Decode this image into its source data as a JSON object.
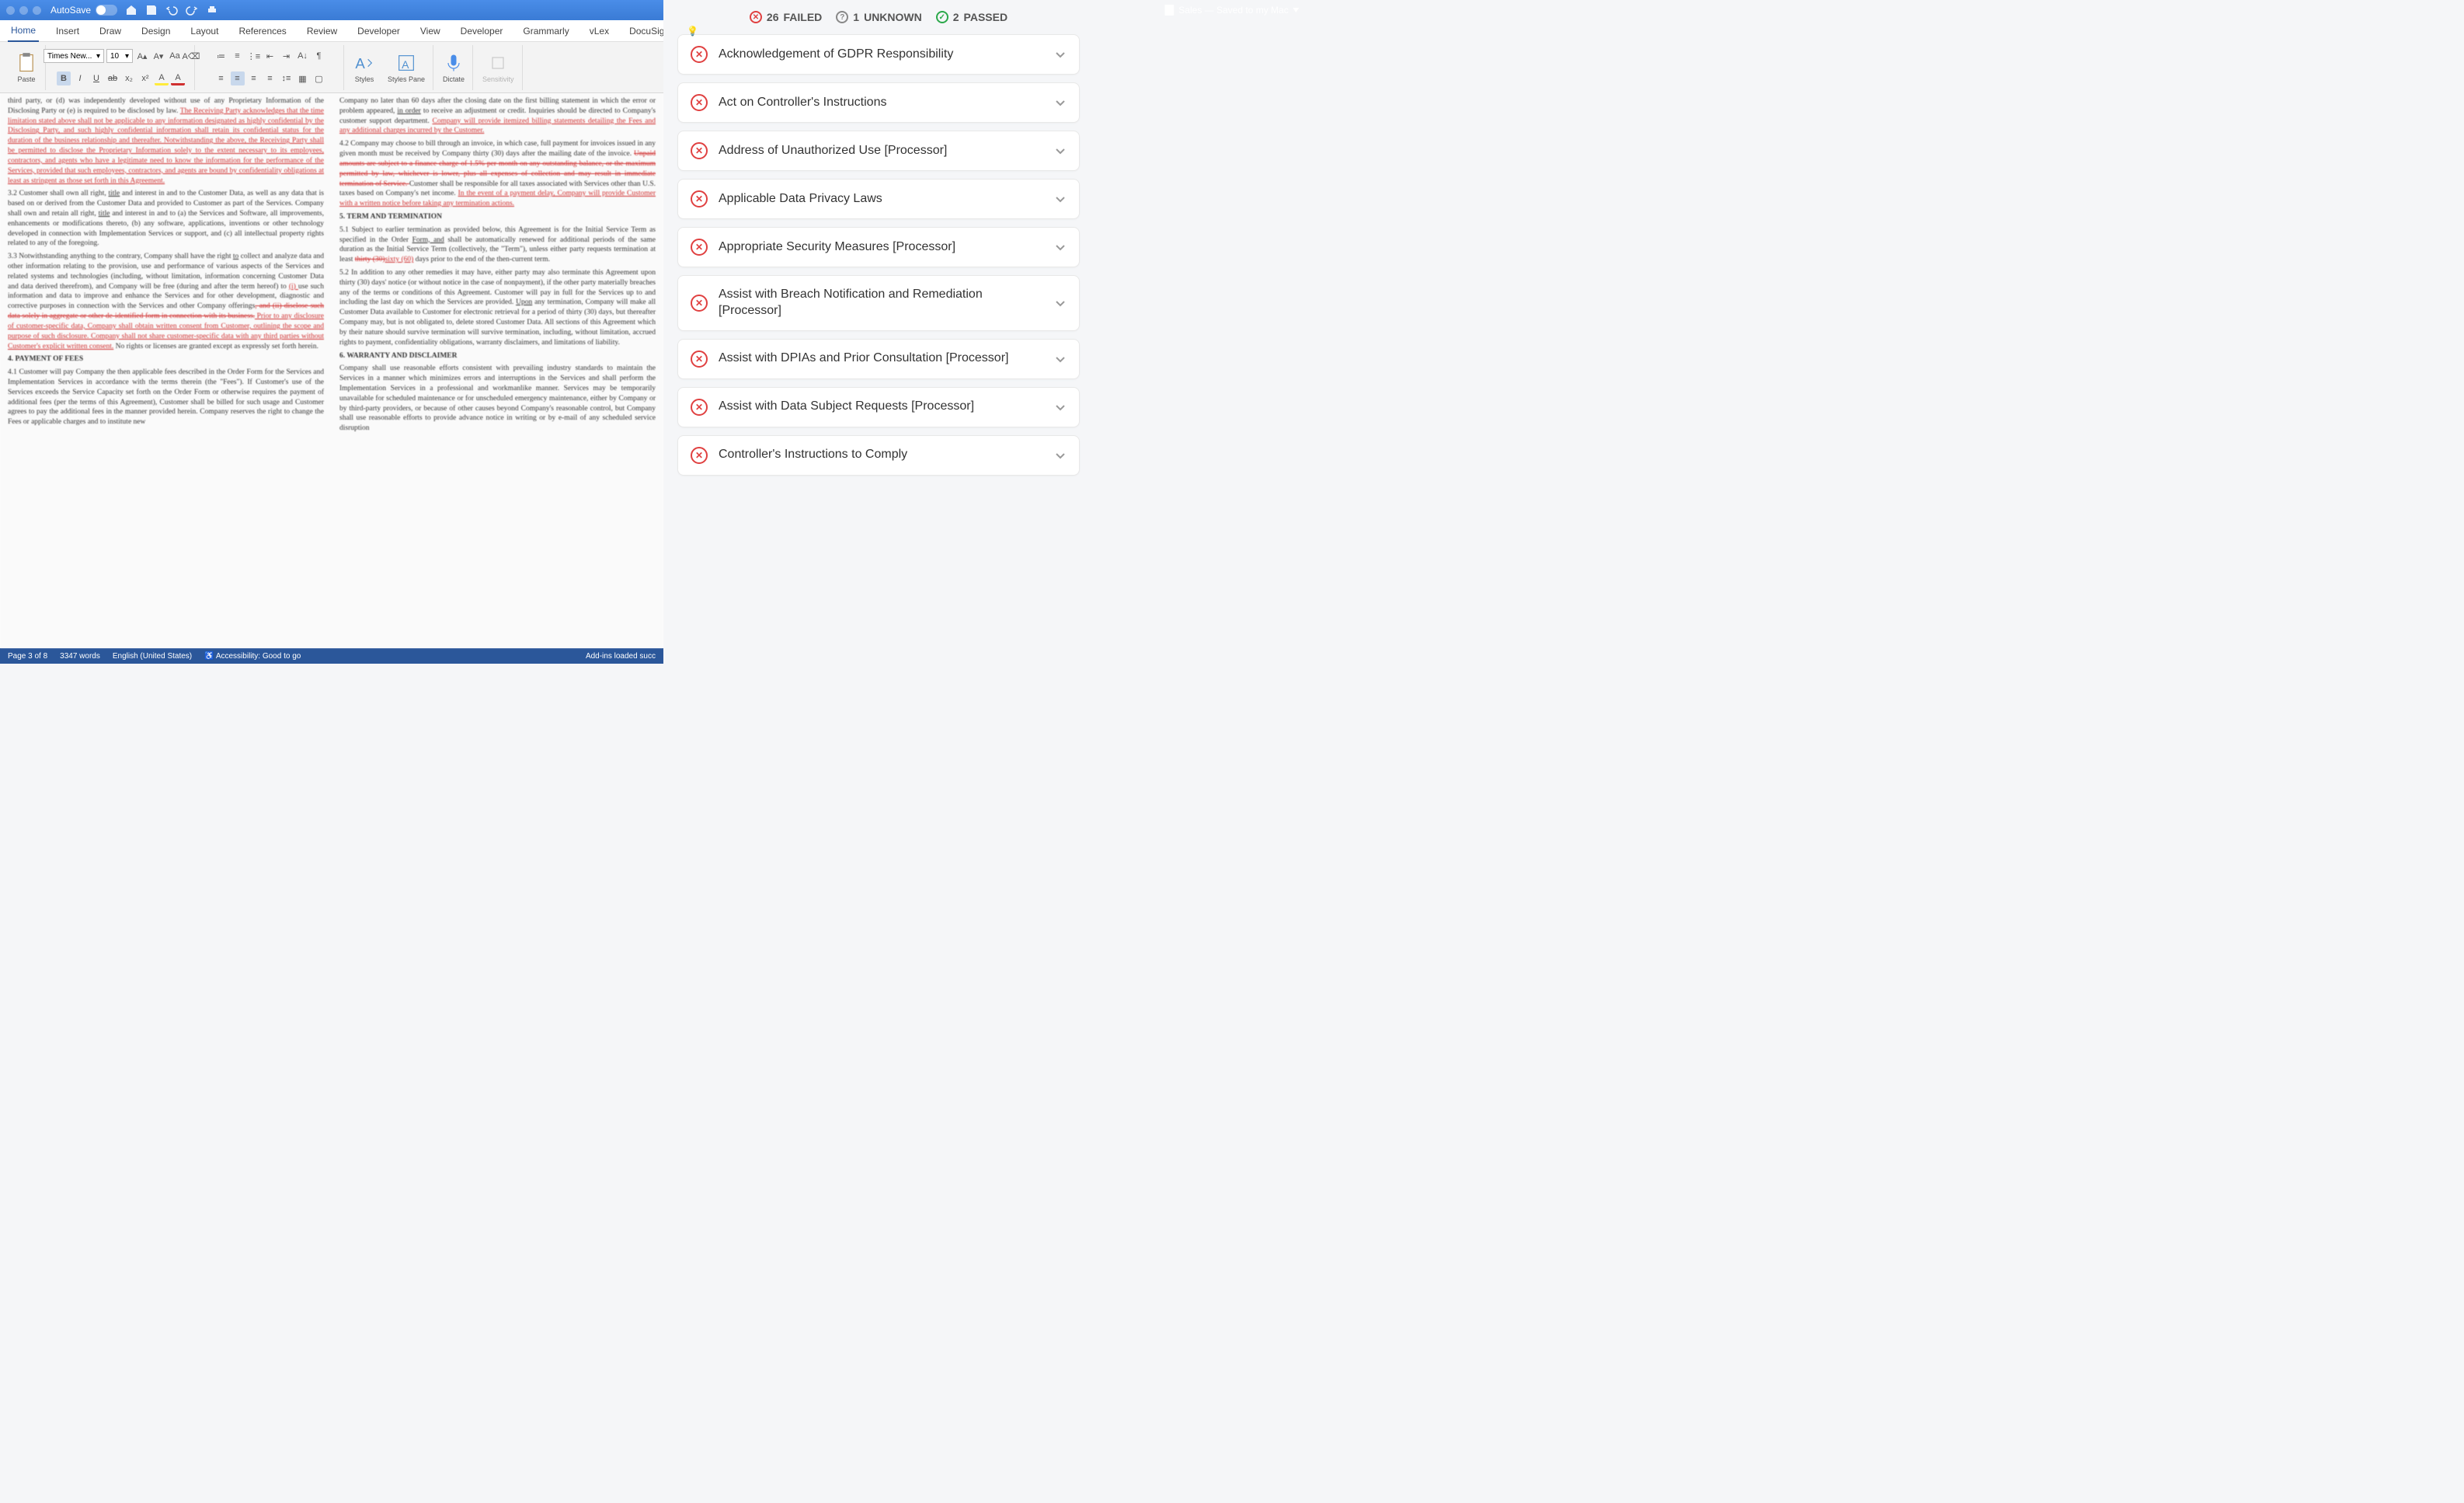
{
  "titlebar": {
    "autosave": "AutoSave",
    "doc_title": "Sales — Saved to my Mac"
  },
  "ribbon_tabs": [
    "Home",
    "Insert",
    "Draw",
    "Design",
    "Layout",
    "References",
    "Review",
    "Developer",
    "View",
    "Developer",
    "Grammarly",
    "vLex",
    "DocuSign"
  ],
  "toolbar": {
    "paste": "Paste",
    "font_name": "Times New...",
    "font_size": "10",
    "styles": "Styles",
    "styles_pane": "Styles Pane",
    "dictate": "Dictate",
    "sensitivity": "Sensitivity"
  },
  "statusbar": {
    "page": "Page 3 of 8",
    "words": "3347 words",
    "lang": "English (United States)",
    "accessibility": "Accessibility: Good to go",
    "addins": "Add-ins loaded succ"
  },
  "doc": {
    "c1_p1a": "third party, or (d) was independently developed without use of any Proprietary Information of the Disclosing Party or (e) is required to be disclosed by law.  ",
    "c1_p1b": "The Receiving Party acknowledges that the time limitation stated above shall not be applicable to any information designated as highly confidential by the Disclosing Party, and such highly confidential information shall retain its confidential status for the duration of the business relationship and thereafter.  Notwithstanding the above, the Receiving Party shall be permitted to disclose the Proprietary Information solely to the extent necessary to its employees, contractors, and agents who have a legitimate need to know the information for the performance of the Services, provided that such employees, contractors, and agents are bound by confidentiality obligations at least as stringent as those set forth in this Agreement.",
    "c1_p2a": "3.2       Customer shall own all right, ",
    "c1_p2_title": "title",
    "c1_p2b": " and interest in and to the Customer Data, as well as any data that is based on or derived from the Customer Data and provided to Customer as part of the Services.  Company shall own and retain all right, ",
    "c1_p2c": " and interest in and to (a) the Services and Software, all improvements, enhancements or modifications thereto, (b) any software, applications, inventions or other technology developed in connection with Implementation Services or support, and (c) all intellectual property rights related to any of the foregoing.",
    "c1_p3a": "3.3       Notwithstanding anything to the contrary, Company shall have the right ",
    "c1_p3_to": "to",
    "c1_p3b": " collect and analyze data and other information relating to the provision, use and performance of various aspects of the Services and related systems and technologies (including, without limitation, information concerning Customer Data and data derived therefrom), and  Company will be free (during and after the term hereof) to ",
    "c1_p3_i": "(i) ",
    "c1_p3c": "use such information and data to improve and enhance the Services and for other development, diagnostic and corrective purposes in connection with the Services and other Company offerings",
    "c1_p3_strike": ", and (ii) disclose such data solely in aggregate or other de-identified form in connection with its business.",
    "c1_p3_red1": "   Prior to any disclosure of customer-specific data, Company shall obtain written consent from Customer, outlining the scope and purpose of such disclosure. Company shall not share customer-specific data with any third parties without Customer's explicit written consent.",
    "c1_p3d": "  No rights or licenses are granted except as expressly set forth herein.",
    "c1_s4": "4.        PAYMENT OF FEES",
    "c1_p4": "4.1       Customer will pay Company the then applicable fees described in the Order Form for the Services and Implementation Services in accordance with the terms therein (the \"Fees\").  If Customer's use of the Services exceeds the Service Capacity set forth on the Order Form or otherwise requires the payment of additional fees (per the terms of this Agreement), Customer shall be billed for such usage and Customer agrees to pay the additional fees in the manner provided herein.  Company reserves the right to change the Fees or applicable charges and to institute new",
    "c2_p1a": "Company no later than 60 days after the closing date on the first billing statement in which the error or problem appeared, ",
    "c2_p1_inorder": "in order",
    "c2_p1b": " to receive an adjustment or credit.  Inquiries should be directed to Company's customer support department.  ",
    "c2_p1_red": "Company will provide itemized billing statements detailing the Fees and any additional charges incurred by the Customer.",
    "c2_p2a": "4.2       Company may choose to bill through an invoice, in which case, full payment for invoices issued in any given month must be received by Company thirty (30) days after the mailing date of the invoice.  ",
    "c2_p2_strike": "Unpaid amounts are subject to a finance charge of 1.5% per month on any outstanding balance, or the maximum permitted by law, whichever is lower, plus all expenses of collection and may result in immediate termination of Service. ",
    "c2_p2b": "Customer shall be responsible for all taxes associated with Services other than U.S. taxes based on Company's net income.  ",
    "c2_p2_red": "In the event of a payment delay, Company will provide Customer with a written notice before taking any termination actions.",
    "c2_s5": "5.        TERM AND TERMINATION",
    "c2_p5a": "5.1       Subject to earlier termination as provided below, this Agreement is for the Initial Service Term as specified in the Order ",
    "c2_p5_form": "Form, and",
    "c2_p5b": " shall be automatically renewed for additional periods of the same duration as the Initial Service Term (collectively, the \"Term\"), unless either party requests termination at least ",
    "c2_p5_strike": "thirty (30)",
    "c2_p5_red": "sixty (60)",
    "c2_p5c": " days prior to the end of the then-current term.",
    "c2_p52a": "5.2       In addition to any other remedies it may have, either party may also terminate this Agreement upon thirty (30) days' notice (or without notice in the case of nonpayment), if the other party materially breaches any of the terms or conditions of this Agreement.  Customer will pay in full for the Services up to and including the last day on which the Services are provided. ",
    "c2_p52_upon": "Upon",
    "c2_p52b": " any termination, Company will make all Customer Data available to Customer for electronic retrieval for a period of thirty (30) days, but thereafter Company may, but is not obligated to, delete stored Customer Data.  All sections of this Agreement which by their nature should survive termination will survive termination, including, without limitation, accrued rights to payment, confidentiality obligations, warranty disclaimers, and limitations of liability.",
    "c2_s6": "6.        WARRANTY AND DISCLAIMER",
    "c2_p6": "         Company shall use reasonable efforts consistent with prevailing industry standards to maintain the Services in a manner which minimizes errors and interruptions in the Services and shall perform the Implementation Services in a professional and workmanlike manner.  Services may be temporarily unavailable for scheduled maintenance or for unscheduled emergency maintenance, either by Company or by third-party providers, or because of other causes beyond Company's reasonable control, but Company shall use reasonable efforts to provide advance notice in writing or by e-mail of any scheduled service disruption"
  },
  "summary": {
    "failed_count": "26",
    "failed_label": "FAILED",
    "unknown_count": "1",
    "unknown_label": "UNKNOWN",
    "passed_count": "2",
    "passed_label": "PASSED"
  },
  "checks": [
    {
      "title": "Acknowledgement of GDPR Responsibility"
    },
    {
      "title": "Act on Controller's Instructions"
    },
    {
      "title": "Address of Unauthorized Use [Processor]"
    },
    {
      "title": "Applicable Data Privacy Laws"
    },
    {
      "title": "Appropriate Security Measures [Processor]"
    },
    {
      "title": "Assist with Breach Notification and Remediation [Processor]"
    },
    {
      "title": "Assist with DPIAs and Prior Consultation [Processor]"
    },
    {
      "title": "Assist with Data Subject Requests [Processor]"
    },
    {
      "title": "Controller's Instructions to Comply"
    }
  ]
}
